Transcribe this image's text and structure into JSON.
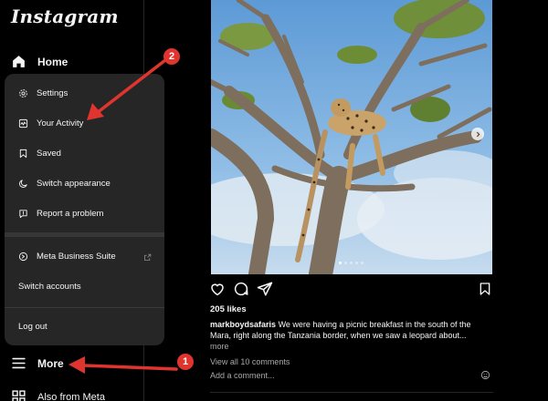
{
  "app": {
    "logo": "Instagram"
  },
  "sidebar": {
    "home_label": "Home",
    "more_label": "More",
    "also_from_meta_label": "Also from Meta"
  },
  "menu": {
    "settings": "Settings",
    "your_activity": "Your Activity",
    "saved": "Saved",
    "switch_appearance": "Switch appearance",
    "report_problem": "Report a problem",
    "meta_business_suite": "Meta Business Suite",
    "switch_accounts": "Switch accounts",
    "log_out": "Log out"
  },
  "post": {
    "likes": "205 likes",
    "username": "markboydsafaris",
    "caption": "We were having a picnic breakfast in the south of the Mara, right along the Tanzania border, when we saw a leopard about...",
    "more": "more",
    "view_all_comments": "View all 10 comments",
    "add_comment_placeholder": "Add a comment...",
    "carousel": {
      "total": 5,
      "current": 1
    }
  },
  "annotations": {
    "badge_1": "1",
    "badge_2": "2"
  },
  "colors": {
    "background": "#000000",
    "menu_bg": "#262626",
    "annotation_red": "#e0342f",
    "text": "#f5f5f5",
    "muted": "#a8a8a8"
  }
}
